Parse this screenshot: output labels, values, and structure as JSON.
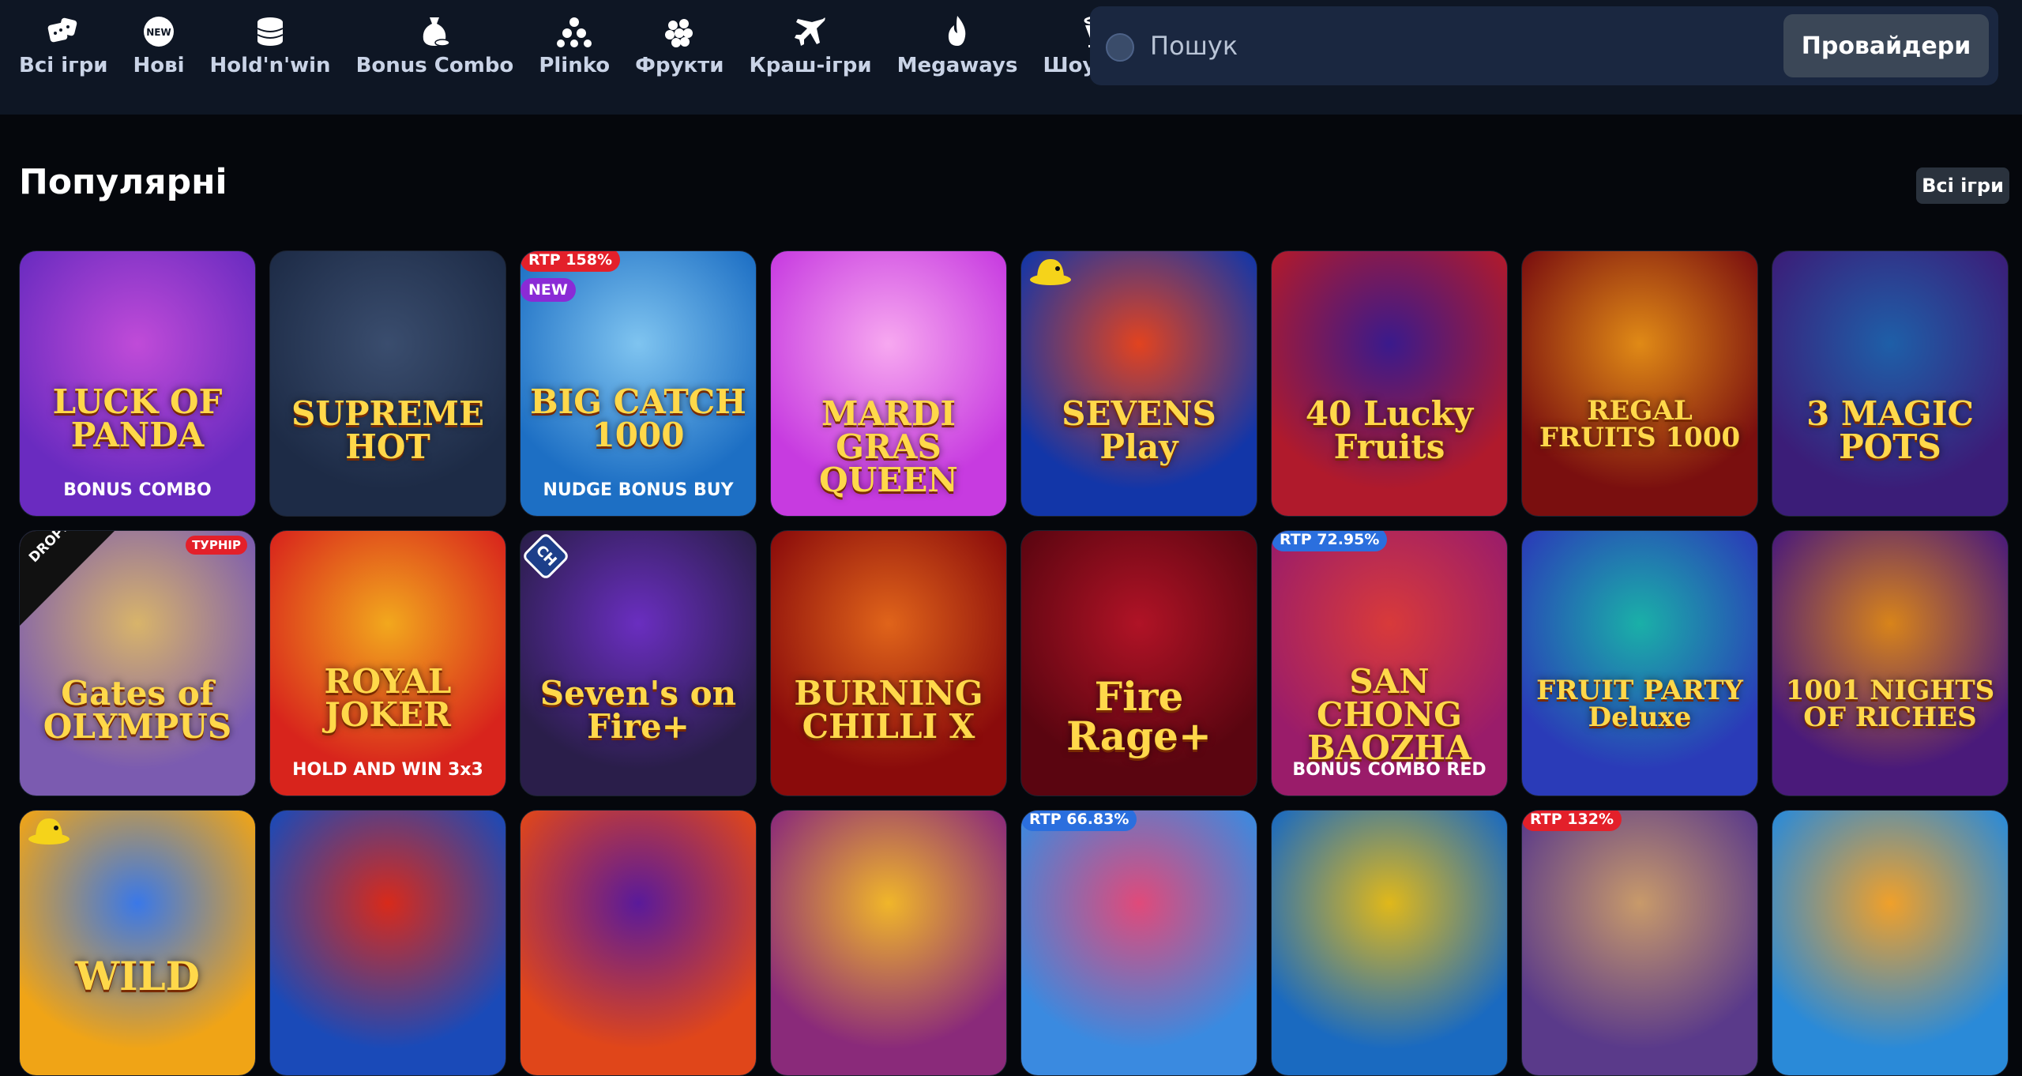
{
  "categories": [
    {
      "label": "Всі ігри",
      "icon": "dice-icon"
    },
    {
      "label": "Нові",
      "icon": "new-badge-icon"
    },
    {
      "label": "Hold'n'win",
      "icon": "coins-stack-icon"
    },
    {
      "label": "Bonus Combo",
      "icon": "money-bag-icon"
    },
    {
      "label": "Plinko",
      "icon": "plinko-balls-icon"
    },
    {
      "label": "Фрукти",
      "icon": "grapes-icon"
    },
    {
      "label": "Краш-ігри",
      "icon": "airplane-icon"
    },
    {
      "label": "Megaways",
      "icon": "flame-icon"
    },
    {
      "label": "Шоу ігри",
      "icon": "cocktail-icon"
    }
  ],
  "new_icon_text": "NEW",
  "search": {
    "placeholder": "Пошук",
    "providers_label": "Провайдери"
  },
  "section": {
    "title": "Популярні",
    "all_label": "Всі ігри"
  },
  "games": [
    {
      "title": "LUCK OF PANDA",
      "subtitle": "BONUS COMBO",
      "bg": "#6a2bc0",
      "bg2": "#c04bd8",
      "badges": []
    },
    {
      "title": "SUPREME HOT",
      "subtitle": "",
      "bg": "#1d2b46",
      "bg2": "#3a4d6e",
      "badges": []
    },
    {
      "title": "BIG CATCH 1000",
      "subtitle": "NUDGE BONUS BUY",
      "bg": "#1d6fc4",
      "bg2": "#7fc4f0",
      "badges": [
        {
          "text": "RTP 158%",
          "style": "rtp-red"
        },
        {
          "text": "NEW",
          "style": "new"
        }
      ]
    },
    {
      "title": "MARDI GRAS QUEEN",
      "subtitle": "",
      "bg": "#c73be0",
      "bg2": "#f7a8f0",
      "badges": []
    },
    {
      "title": "SEVENS Play",
      "subtitle": "",
      "bg": "#1236a8",
      "bg2": "#e2431f",
      "badges": [],
      "hat": true
    },
    {
      "title": "40 Lucky Fruits",
      "subtitle": "",
      "bg": "#b01a2c",
      "bg2": "#3a1a8c",
      "badges": []
    },
    {
      "title": "REGAL FRUITS 1000",
      "subtitle": "",
      "bg": "#7a0f0f",
      "bg2": "#e08a16",
      "badges": []
    },
    {
      "title": "3 MAGIC POTS",
      "subtitle": "",
      "bg": "#3b1d78",
      "bg2": "#1e5fa8",
      "badges": []
    },
    {
      "title": "Gates of OLYMPUS",
      "subtitle": "",
      "bg": "#7b5bb0",
      "bg2": "#d8b46a",
      "badges": [
        {
          "text": "ТУРНІР",
          "style": "tournament"
        }
      ],
      "corner": "DROPS & WINS"
    },
    {
      "title": "ROYAL JOKER",
      "subtitle": "HOLD AND WIN 3x3",
      "bg": "#d8241c",
      "bg2": "#f2a81d",
      "badges": []
    },
    {
      "title": "Seven's on Fire+",
      "subtitle": "",
      "bg": "#2a1e4a",
      "bg2": "#6a2ec0",
      "badges": [],
      "provider": "CH"
    },
    {
      "title": "BURNING CHILLI X",
      "subtitle": "",
      "bg": "#8a0b0b",
      "bg2": "#e0641a",
      "badges": []
    },
    {
      "title": "Fire Rage+",
      "subtitle": "",
      "bg": "#5a0510",
      "bg2": "#b01326",
      "badges": []
    },
    {
      "title": "SAN CHONG BAOZHA",
      "subtitle": "BONUS COMBO RED",
      "bg": "#9a1c6a",
      "bg2": "#d83a3a",
      "badges": [
        {
          "text": "RTP 72.95%",
          "style": "rtp-blue"
        }
      ]
    },
    {
      "title": "FRUIT PARTY Deluxe",
      "subtitle": "",
      "bg": "#2a3bb8",
      "bg2": "#1ab0a8",
      "badges": []
    },
    {
      "title": "1001 NIGHTS OF RICHES",
      "subtitle": "",
      "bg": "#4a1a7a",
      "bg2": "#d8841a",
      "badges": []
    },
    {
      "title": "WILD",
      "subtitle": "",
      "bg": "#f0a416",
      "bg2": "#3a78e8",
      "badges": [],
      "hat": true
    },
    {
      "title": "",
      "subtitle": "",
      "bg": "#1a4ab8",
      "bg2": "#d82a1a",
      "badges": []
    },
    {
      "title": "",
      "subtitle": "",
      "bg": "#e0461a",
      "bg2": "#5a1a9a",
      "badges": []
    },
    {
      "title": "",
      "subtitle": "",
      "bg": "#8a2a7a",
      "bg2": "#f0b62a",
      "badges": []
    },
    {
      "title": "",
      "subtitle": "",
      "bg": "#3a8ae0",
      "bg2": "#e04a7a",
      "badges": [
        {
          "text": "RTP 66.83%",
          "style": "rtp-blue"
        }
      ]
    },
    {
      "title": "",
      "subtitle": "",
      "bg": "#1a6ac0",
      "bg2": "#e0b81a",
      "badges": []
    },
    {
      "title": "",
      "subtitle": "",
      "bg": "#5a3a8a",
      "bg2": "#c89a6a",
      "badges": [
        {
          "text": "RTP 132%",
          "style": "rtp-red"
        }
      ]
    },
    {
      "title": "",
      "subtitle": "",
      "bg": "#2a8ad8",
      "bg2": "#f0a02a",
      "badges": []
    }
  ]
}
